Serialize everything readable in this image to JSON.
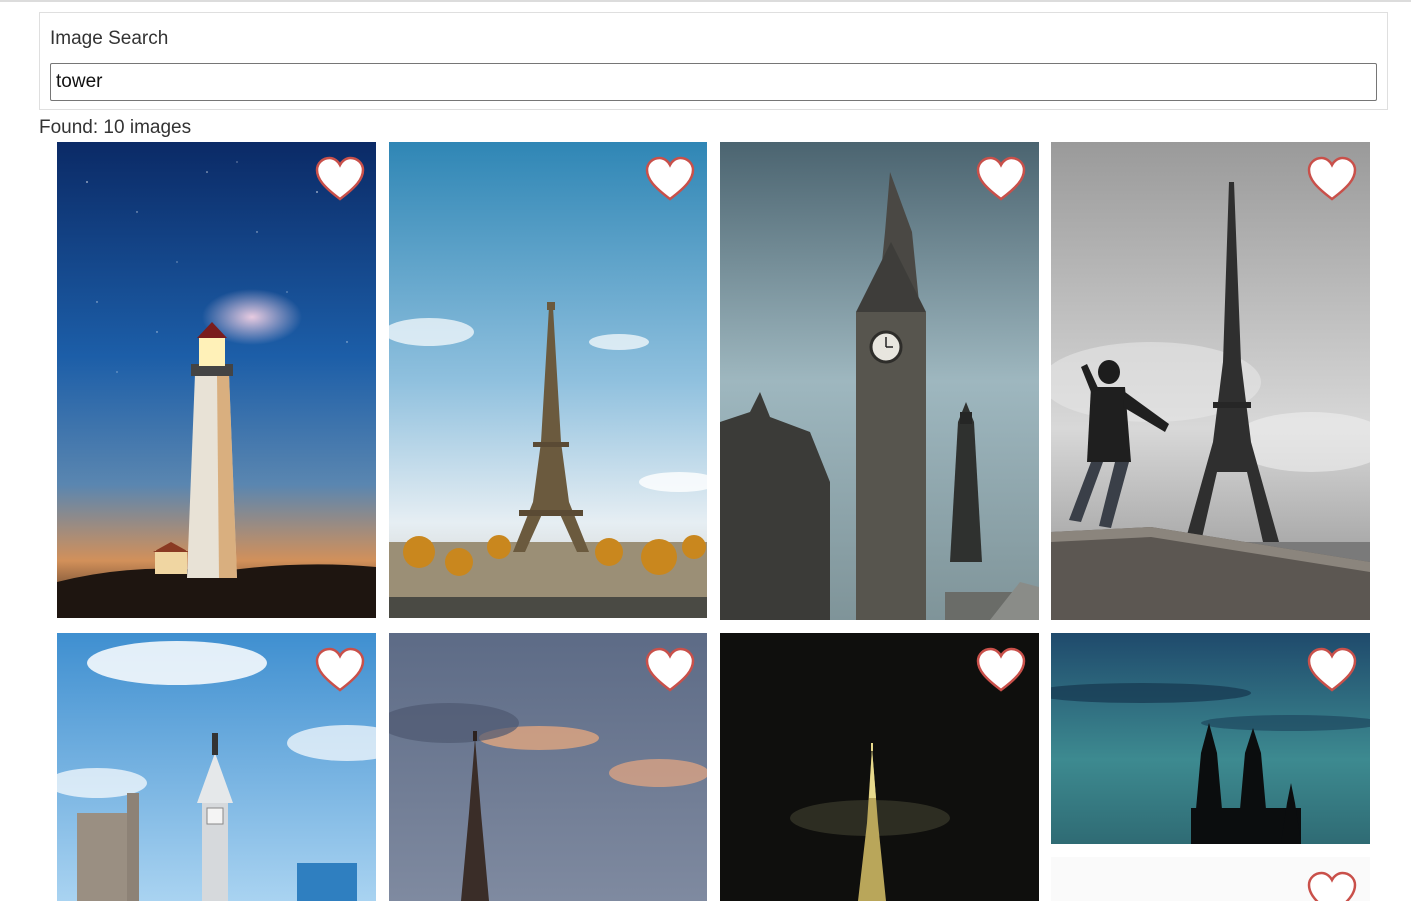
{
  "search": {
    "label": "Image Search",
    "value": "tower"
  },
  "results": {
    "found_text": "Found: 10 images",
    "count": 10
  },
  "images": [
    {
      "subject": "lighthouse at night",
      "favorite": false
    },
    {
      "subject": "eiffel tower blue sky",
      "favorite": false
    },
    {
      "subject": "big ben clock tower",
      "favorite": false
    },
    {
      "subject": "man in front of eiffel tower",
      "favorite": false
    },
    {
      "subject": "city hall tower",
      "favorite": false
    },
    {
      "subject": "church spire at dusk",
      "favorite": false
    },
    {
      "subject": "skyscraper at night",
      "favorite": false
    },
    {
      "subject": "cathedral silhouette",
      "favorite": false
    },
    {
      "subject": "white image partially visible",
      "favorite": false
    }
  ],
  "icons": {
    "favorite": "heart-outline-icon"
  },
  "colors": {
    "heart_stroke": "#c9504a",
    "heart_fill": "#ffffff"
  }
}
